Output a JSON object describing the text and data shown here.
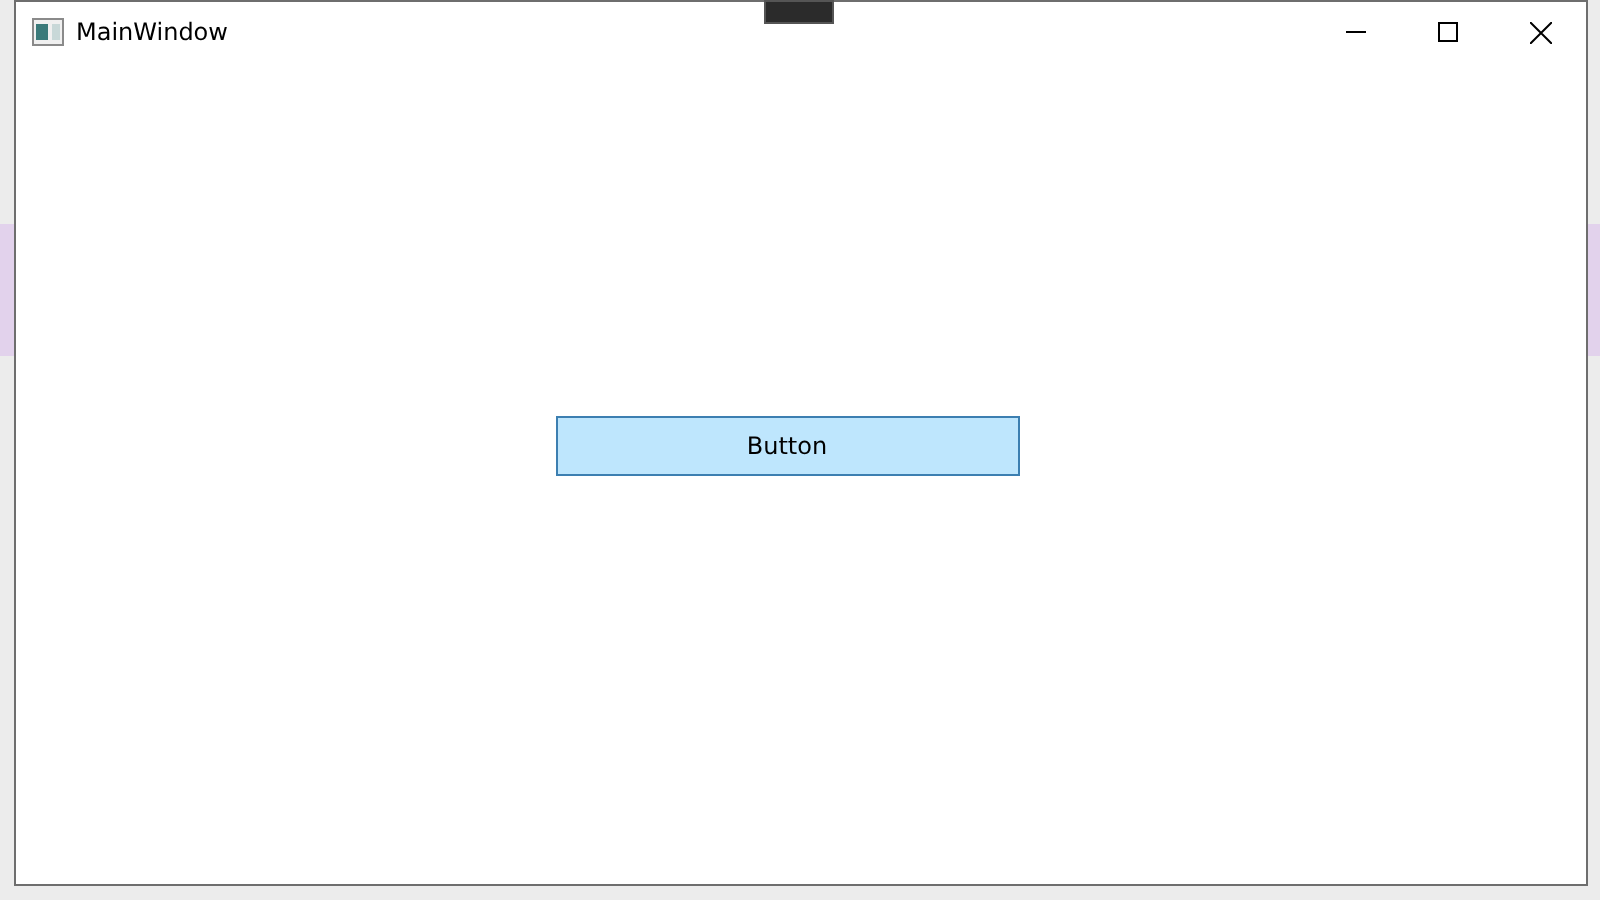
{
  "window": {
    "title": "MainWindow"
  },
  "button": {
    "label": "Button"
  }
}
